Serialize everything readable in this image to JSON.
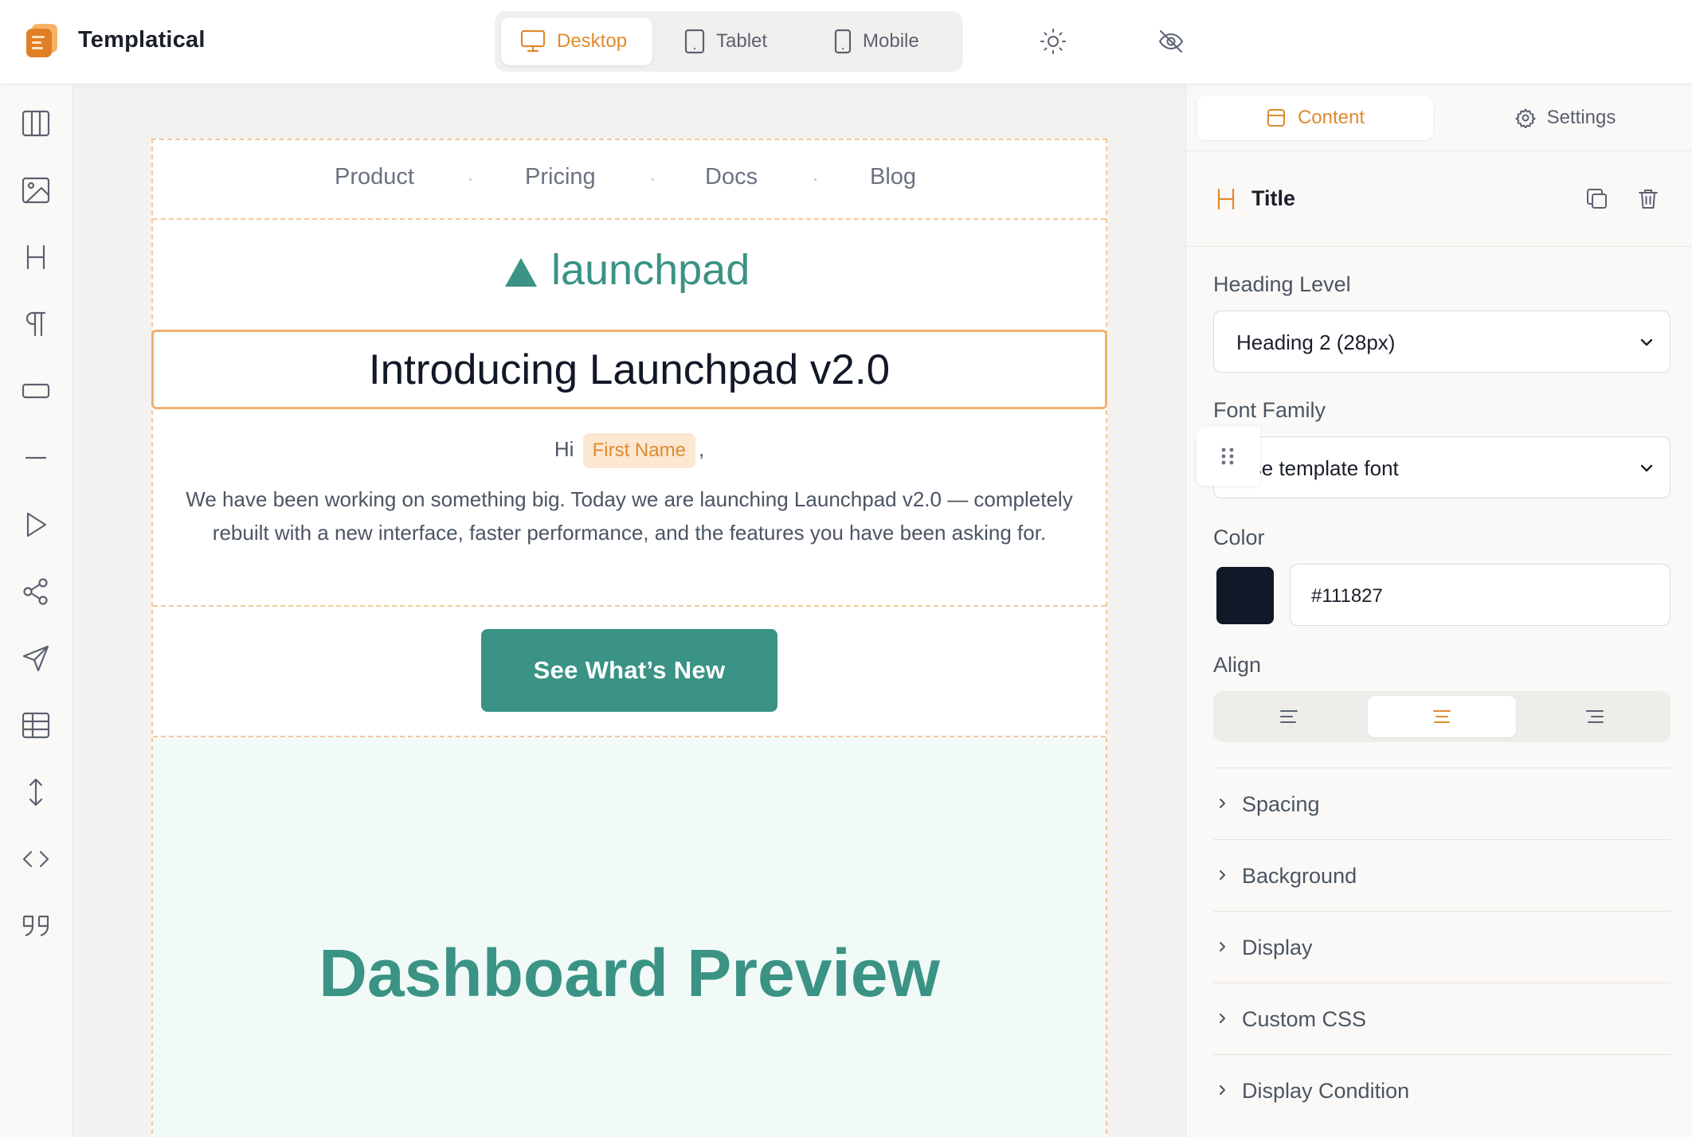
{
  "app": {
    "name": "Templatical"
  },
  "topbar": {
    "devices": [
      {
        "label": "Desktop",
        "icon": "monitor-icon",
        "active": true
      },
      {
        "label": "Tablet",
        "icon": "tablet-icon",
        "active": false
      },
      {
        "label": "Mobile",
        "icon": "mobile-icon",
        "active": false
      }
    ],
    "theme_toggle_icon": "sun-icon",
    "preview_toggle_icon": "eye-off-icon"
  },
  "left_rail": {
    "tools": [
      "columns-icon",
      "image-icon",
      "heading-icon",
      "paragraph-icon",
      "button-icon",
      "divider-icon",
      "video-icon",
      "social-icon",
      "send-icon",
      "table-icon",
      "spacer-icon",
      "code-icon",
      "quote-icon"
    ]
  },
  "email": {
    "nav": [
      "Product",
      "Pricing",
      "Docs",
      "Blog"
    ],
    "brand": "launchpad",
    "title": "Introducing Launchpad v2.0",
    "greeting_prefix": "Hi",
    "merge_tag": "First Name",
    "greeting_suffix": ",",
    "body": "We have been working on something big. Today we are launching Launchpad v2.0 — completely rebuilt with a new interface, faster performance, and the features you have been asking for.",
    "cta": "See What’s New",
    "hero_title": "Dashboard Preview"
  },
  "panel": {
    "tabs": [
      {
        "label": "Content",
        "active": true
      },
      {
        "label": "Settings",
        "active": false
      }
    ],
    "block": {
      "type_icon": "heading-icon",
      "name": "Title"
    },
    "heading_level": {
      "label": "Heading Level",
      "value": "Heading 2 (28px)"
    },
    "font_family": {
      "label": "Font Family",
      "value": "Use template font"
    },
    "color": {
      "label": "Color",
      "value": "#111827"
    },
    "align": {
      "label": "Align",
      "selected": "center"
    },
    "sections": [
      "Spacing",
      "Background",
      "Display",
      "Custom CSS",
      "Display Condition"
    ]
  },
  "colors": {
    "accent": "#e08a2e",
    "brand_teal": "#3a9384",
    "title_color": "#111827",
    "selection_border": "#f0b271"
  }
}
